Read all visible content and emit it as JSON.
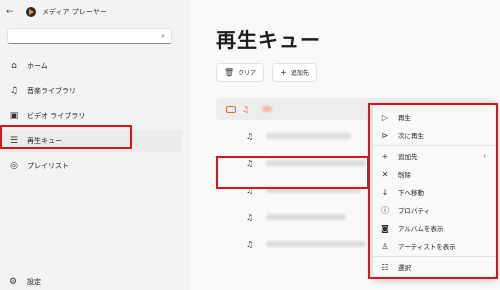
{
  "app": {
    "title": "メディア プレーヤー"
  },
  "search": {
    "placeholder": ""
  },
  "nav": [
    {
      "label": "ホーム",
      "icon": "home-icon"
    },
    {
      "label": "音楽ライブラリ",
      "icon": "music-icon"
    },
    {
      "label": "ビデオ ライブラリ",
      "icon": "video-icon"
    },
    {
      "label": "再生キュー",
      "icon": "queue-icon",
      "active": true
    },
    {
      "label": "プレイリスト",
      "icon": "playlist-icon"
    }
  ],
  "settings": {
    "label": "設定"
  },
  "main": {
    "title": "再生キュー",
    "toolbar": {
      "clear_label": "クリア",
      "add_label": "追加先"
    }
  },
  "context_menu": {
    "items": [
      {
        "label": "再生",
        "icon": "play-icon"
      },
      {
        "label": "次に再生",
        "icon": "play-next-icon"
      },
      {
        "label": "追加先",
        "icon": "plus-icon",
        "submenu": true
      },
      {
        "label": "削除",
        "icon": "close-icon"
      },
      {
        "label": "下へ移動",
        "icon": "arrow-down-icon"
      },
      {
        "label": "プロパティ",
        "icon": "info-icon"
      },
      {
        "label": "アルバムを表示",
        "icon": "album-icon"
      },
      {
        "label": "アーティストを表示",
        "icon": "person-icon"
      },
      {
        "label": "選択",
        "icon": "select-icon"
      }
    ]
  },
  "colors": {
    "highlight": "#d9141c",
    "accent": "#e8693f"
  }
}
